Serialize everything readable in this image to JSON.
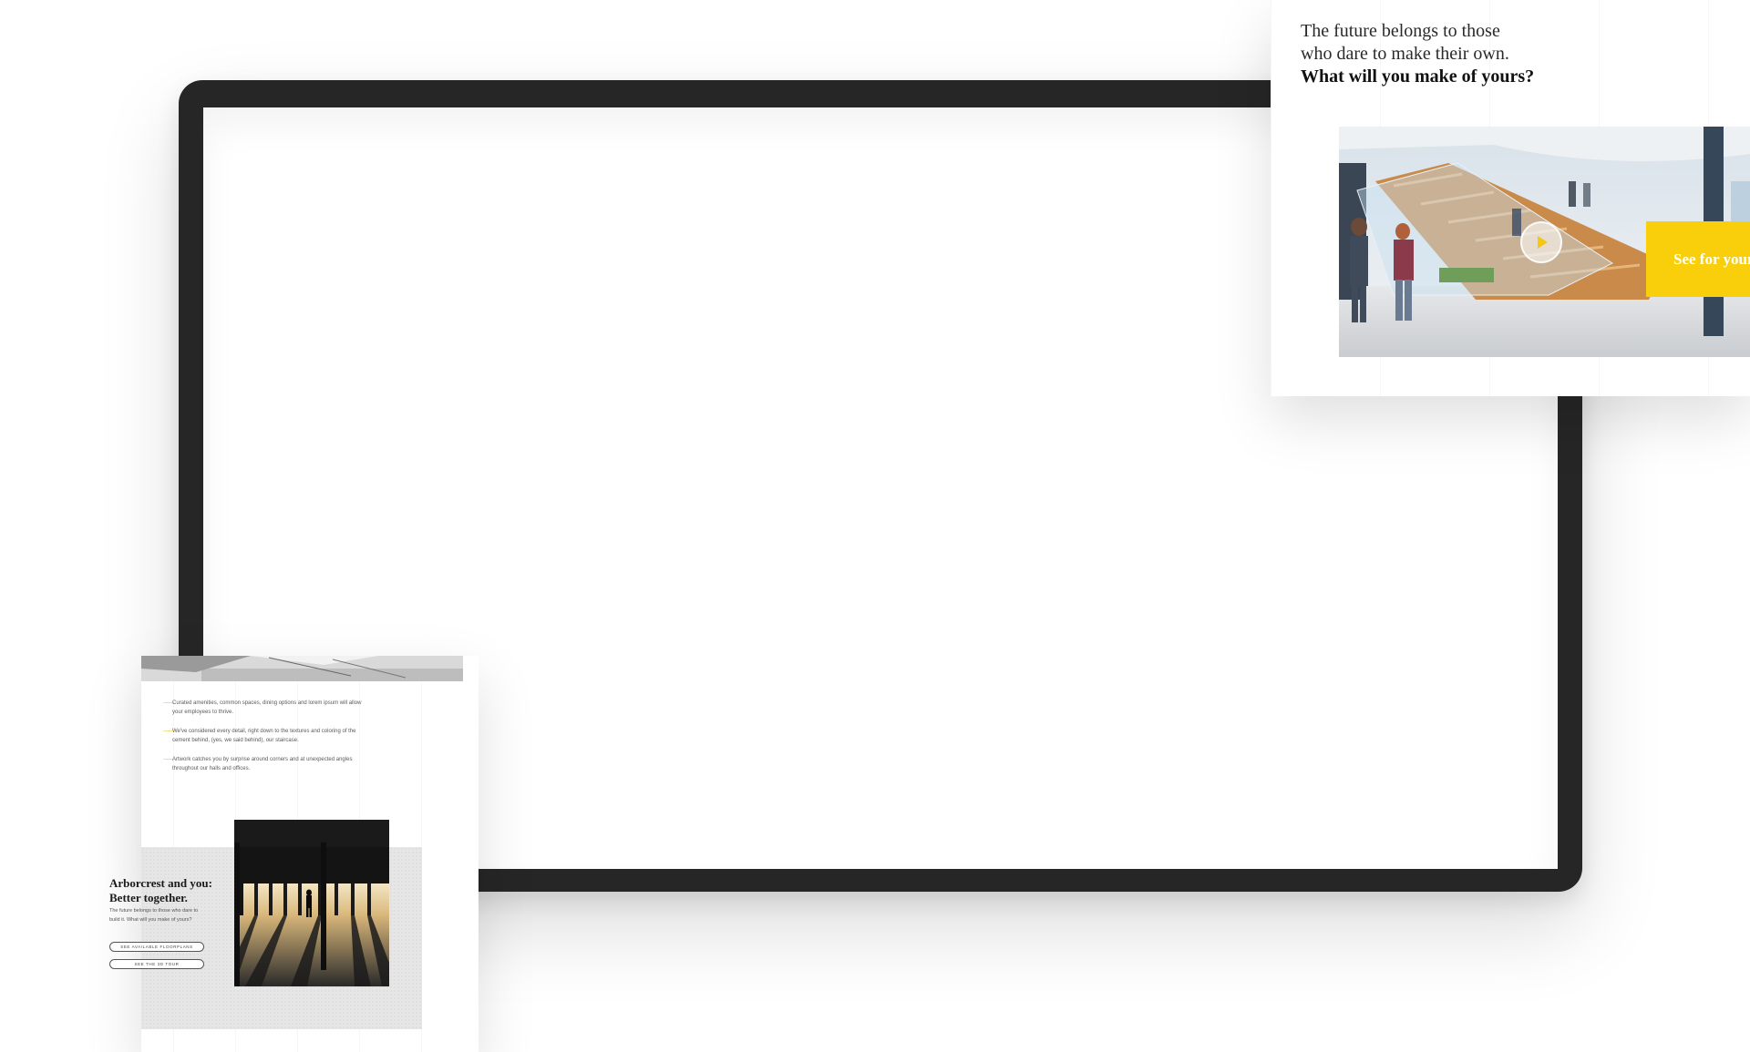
{
  "video_card": {
    "heading_line1": "The future belongs to those",
    "heading_line2": "who dare to make their own.",
    "heading_strong": "What will you make of yours?",
    "cta_label": "See for yourself"
  },
  "features_card": {
    "bullets": [
      "Curated amenities, common spaces, dining options and lorem ipsum will allow your employees to thrive.",
      "We've considered every detail, right down to the textures and coloring of the cement behind, (yes, we said behind), our staircase.",
      "Artwork catches you by surprise around corners and at unexpected angles throughout our halls and offices."
    ],
    "heading_line1": "Arborcrest and you:",
    "heading_line2": "Better together.",
    "body_text": "The future belongs to those who dare to build it. What will you make of yours?",
    "button_floorplans": "SEE AVAILABLE FLOORPLANS",
    "button_tour": "SEE THE 3D TOUR"
  },
  "colors": {
    "accent_yellow": "#f9cf0b",
    "device_frame": "#262626"
  }
}
